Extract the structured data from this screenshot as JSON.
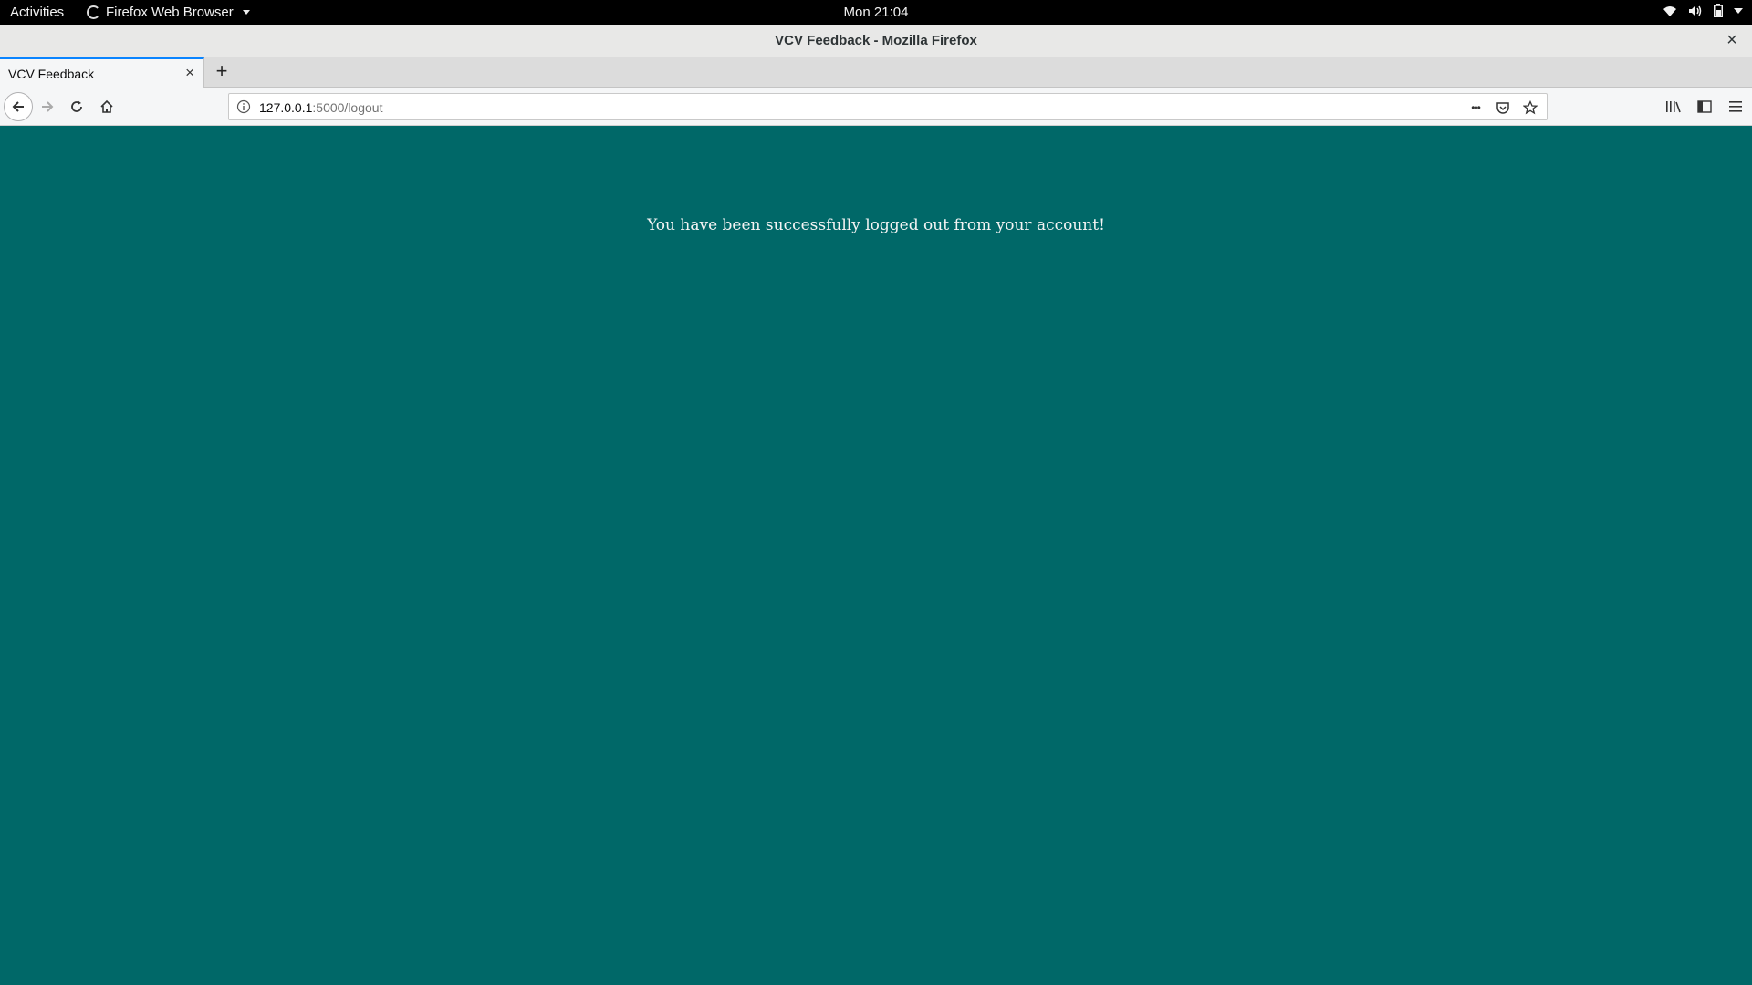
{
  "topbar": {
    "activities": "Activities",
    "app_menu": "Firefox Web Browser",
    "clock": "Mon 21:04",
    "tray_icons": [
      "wifi-icon",
      "volume-icon",
      "battery-icon",
      "chevron-down-icon"
    ]
  },
  "window": {
    "title": "VCV Feedback - Mozilla Firefox",
    "close_glyph": "×"
  },
  "tabs": [
    {
      "label": "VCV Feedback",
      "active": true,
      "close_glyph": "×"
    }
  ],
  "newtab_glyph": "+",
  "navbar": {
    "url_host": "127.0.0.1",
    "url_path": ":5000/logout",
    "page_actions_glyph": "•••"
  },
  "page": {
    "background": "#006868",
    "message": "You have been successfully logged out from your account!"
  }
}
